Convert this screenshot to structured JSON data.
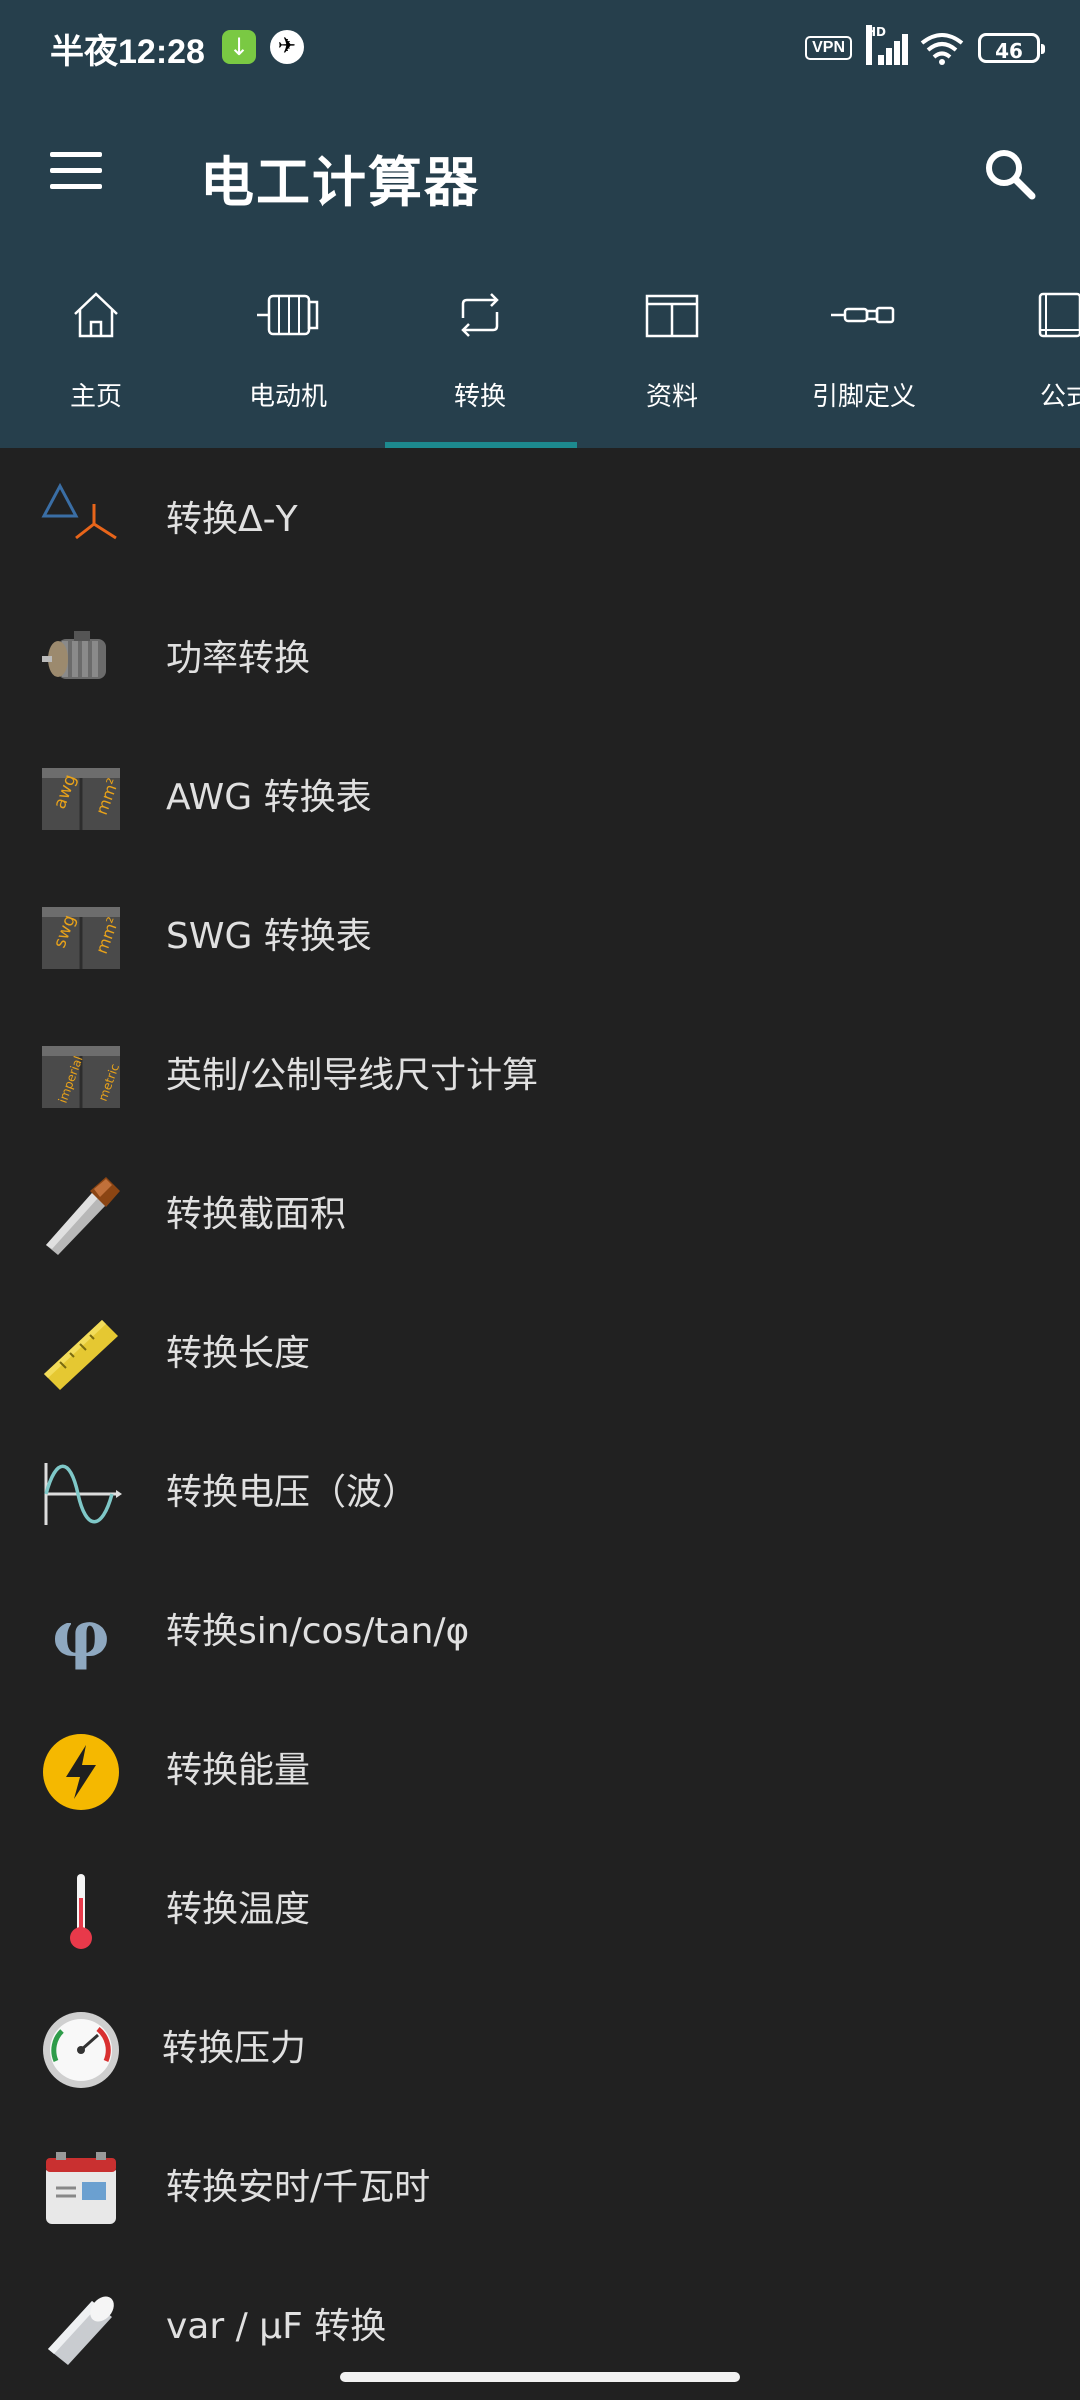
{
  "status": {
    "time": "半夜12:28",
    "vpn": "VPN",
    "network": "HD",
    "battery": "46"
  },
  "appbar": {
    "title": "电工计算器"
  },
  "tabs": [
    {
      "label": "主页",
      "icon": "home-icon"
    },
    {
      "label": "电动机",
      "icon": "motor-icon"
    },
    {
      "label": "转换",
      "icon": "convert-icon",
      "selected": true
    },
    {
      "label": "资料",
      "icon": "table-icon"
    },
    {
      "label": "引脚定义",
      "icon": "connector-icon"
    },
    {
      "label": "公式",
      "icon": "book-icon"
    }
  ],
  "items": [
    {
      "label": "转换Δ-Y",
      "icon": "delta-wye-icon"
    },
    {
      "label": "功率转换",
      "icon": "motor-icon"
    },
    {
      "label": "AWG 转换表",
      "icon": "awg-table-icon",
      "tag1": "awg",
      "tag2": "mm²"
    },
    {
      "label": "SWG 转换表",
      "icon": "swg-table-icon",
      "tag1": "swg",
      "tag2": "mm²"
    },
    {
      "label": "英制/公制导线尺寸计算",
      "icon": "imperial-metric-icon",
      "tag1": "imperial",
      "tag2": "metric"
    },
    {
      "label": "转换截面积",
      "icon": "wire-icon"
    },
    {
      "label": "转换长度",
      "icon": "ruler-icon"
    },
    {
      "label": "转换电压（波）",
      "icon": "sine-wave-icon"
    },
    {
      "label": "转换sin/cos/tan/φ",
      "icon": "phi-icon",
      "glyph": "φ"
    },
    {
      "label": "转换能量",
      "icon": "energy-icon"
    },
    {
      "label": "转换温度",
      "icon": "thermometer-icon"
    },
    {
      "label": "转换压力",
      "icon": "gauge-icon"
    },
    {
      "label": "转换安时/千瓦时",
      "icon": "battery-icon"
    },
    {
      "label": "var / µF 转换",
      "icon": "capacitor-icon"
    }
  ],
  "colors": {
    "header": "#263f4c",
    "background": "#212121",
    "accent": "#1d8a8f"
  }
}
